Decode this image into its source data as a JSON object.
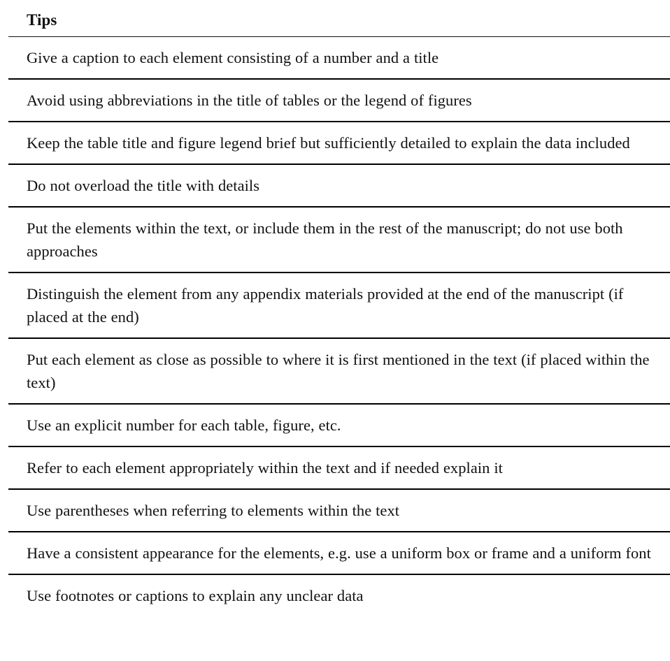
{
  "table": {
    "header": {
      "title": "Tips"
    },
    "rows": [
      {
        "text": "Give a caption to each element consisting of a number and a title"
      },
      {
        "text": "Avoid using abbreviations in the title of tables or the legend of figures"
      },
      {
        "text": "Keep the table title and figure legend brief but sufficiently detailed to explain the data included"
      },
      {
        "text": "Do not overload the title with details"
      },
      {
        "text": "Put the elements within the text, or include them in the rest of the manuscript; do not use both approaches"
      },
      {
        "text": "Distinguish the element from any appendix materials provided at the end of the manuscript (if placed at the end)"
      },
      {
        "text": "Put each element as close as possible to where it is first mentioned in the text (if placed within the text)"
      },
      {
        "text": "Use an explicit number for each table, figure, etc."
      },
      {
        "text": "Refer to each element appropriately within the text and if needed explain it"
      },
      {
        "text": "Use parentheses when referring to elements within the text"
      },
      {
        "text": "Have a consistent appearance for the elements, e.g. use a uniform box or frame and a uniform font"
      },
      {
        "text": "Use footnotes or captions to explain any unclear data"
      }
    ]
  }
}
